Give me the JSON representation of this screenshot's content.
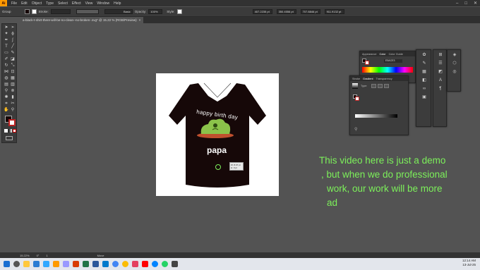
{
  "menubar": {
    "logo": "Ai",
    "items": [
      "File",
      "Edit",
      "Object",
      "Type",
      "Select",
      "Effect",
      "View",
      "Window",
      "Help"
    ]
  },
  "control_bar": {
    "selection": "Group",
    "stroke_label": "Stroke:",
    "brush_label": "Basic",
    "opacity_label": "Opacity:",
    "opacity_value": "100%",
    "style_label": "Style:",
    "x_value": "407.2235 pt",
    "y_value": "350.4556 pt",
    "w_value": "707.8846 pt",
    "h_value": "911.9132 pt"
  },
  "document_tab": {
    "title": "a-black-t-shirt-there-will-be-no-clean--no-broken-.svg* @ 15.22 % (RGB/Preview)",
    "close": "×"
  },
  "artboard": {
    "headline": "happy birth day",
    "name": "papa",
    "tooltip_line1": "W: 8.07 pt",
    "tooltip_line2": "H: 0 pt"
  },
  "overlay_text": {
    "lines": [
      "This video here is just a demo",
      ", but when we do professional",
      "work, our work will be more",
      "ad"
    ]
  },
  "panels": {
    "color": {
      "tabs": [
        "Appearance",
        "Color",
        "Color Guide"
      ],
      "hex": "E5ACE3"
    },
    "gradient": {
      "tabs": [
        "Stroke",
        "Gradient",
        "Transparency"
      ],
      "type_label": "Type:"
    }
  },
  "status_bar": {
    "zoom": "15.22%",
    "rotation": "0°",
    "page": "1",
    "tool": "Move"
  },
  "taskbar": {
    "time": "12:14 AM",
    "date": "13-Jul-25"
  },
  "colors": {
    "accent": "#FF9A00",
    "shirt": "#160808",
    "overlay_text": "#7CF05A",
    "cake_green": "#8BC34A",
    "cake_plate": "#C0502E"
  }
}
